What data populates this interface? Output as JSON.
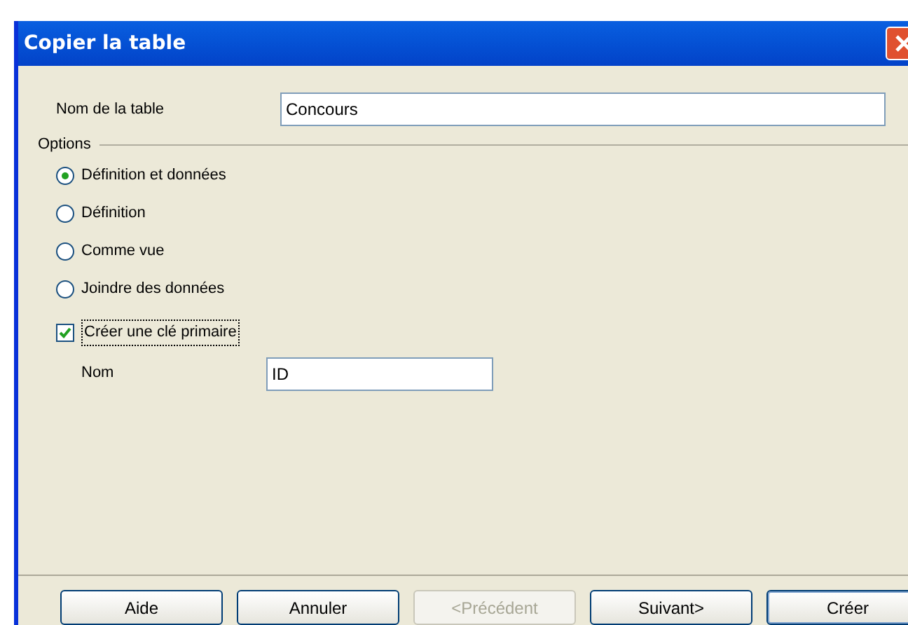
{
  "window": {
    "title": "Copier la table"
  },
  "table_name": {
    "label": "Nom de la table",
    "value": "Concours"
  },
  "options": {
    "label": "Options",
    "radios": [
      {
        "label": "Définition et données",
        "selected": true
      },
      {
        "label": "Définition",
        "selected": false
      },
      {
        "label": "Comme vue",
        "selected": false
      },
      {
        "label": "Joindre des données",
        "selected": false
      }
    ],
    "primary_key": {
      "label": "Créer une clé primaire",
      "checked": true
    },
    "key_name": {
      "label": "Nom",
      "value": "ID"
    }
  },
  "buttons": [
    {
      "label": "Aide",
      "disabled": false,
      "default": false
    },
    {
      "label": "Annuler",
      "disabled": false,
      "default": false
    },
    {
      "label": "<Précédent",
      "disabled": true,
      "default": false
    },
    {
      "label": "Suivant>",
      "disabled": false,
      "default": false
    },
    {
      "label": "Créer",
      "disabled": false,
      "default": true
    }
  ]
}
